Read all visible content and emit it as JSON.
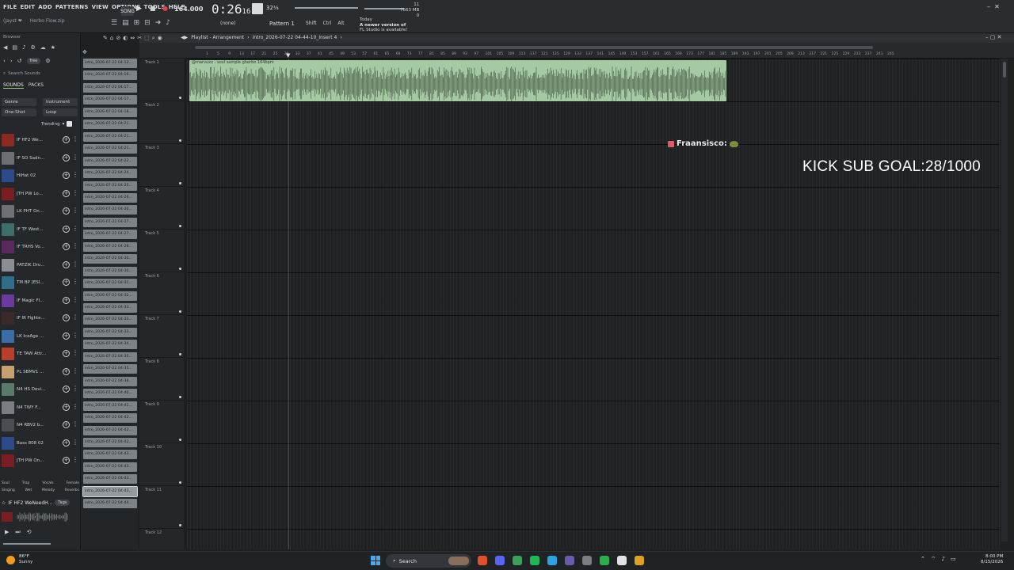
{
  "menu": [
    "FILE",
    "EDIT",
    "ADD",
    "PATTERNS",
    "VIEW",
    "OPTIONS",
    "TOOLS",
    "HELP"
  ],
  "hint_left": "(Jayst ❤",
  "hint_file": "Herbo Flow.zip",
  "transport": {
    "song_label": "SONG",
    "tempo": "164.000",
    "time_main": "0:26",
    "time_sub": "16",
    "snap": "32⅓"
  },
  "cpu": {
    "line1": "11",
    "line2": "7663 MB",
    "line3": "0"
  },
  "pattern_select": "(none)",
  "pattern": "Pattern 1",
  "modifier_keys": [
    "Shift",
    "Ctrl",
    "Alt"
  ],
  "update_notice": {
    "when": "Today",
    "text": "A newer version of",
    "text2": "FL Studio is available!"
  },
  "browser": {
    "title": "Browser",
    "free_pill": "free",
    "search_placeholder": "Search Sounds",
    "tabs": [
      "SOUNDS",
      "PACKS"
    ],
    "filters": [
      [
        "Genre",
        "Instrument"
      ],
      [
        "One-Shot",
        "Loop"
      ]
    ],
    "trending": "Trending",
    "sounds": [
      {
        "label": "IF HF2 We...",
        "color": "#8b2a1e"
      },
      {
        "label": "IF SO Sadn...",
        "color": "#6b6f73"
      },
      {
        "label": "HiHat 02",
        "color": "#2b4b8c"
      },
      {
        "label": "JTH PW Lo...",
        "color": "#7a1e22"
      },
      {
        "label": "LK PHT On...",
        "color": "#6d7175"
      },
      {
        "label": "IF TF West...",
        "color": "#3c6e6a"
      },
      {
        "label": "IF TRHS Vo...",
        "color": "#5a2a5e"
      },
      {
        "label": "PATZIK Dru...",
        "color": "#8a8e92"
      },
      {
        "label": "TM BP [ESI...",
        "color": "#2d6e8a"
      },
      {
        "label": "IF Magic Fl...",
        "color": "#6a3a9c"
      },
      {
        "label": "IF IR Fighte...",
        "color": "#3a2a2a"
      },
      {
        "label": "LK IceAge ...",
        "color": "#3a6ea8"
      },
      {
        "label": "TE TAW Attr...",
        "color": "#b8402a"
      },
      {
        "label": "PL SBMV1 ...",
        "color": "#c8a070"
      },
      {
        "label": "N4 HS Devi...",
        "color": "#5a7a6a"
      },
      {
        "label": "N4 TWY F...",
        "color": "#7a7e82"
      },
      {
        "label": "N4 RBV2 b...",
        "color": "#4a4e52"
      },
      {
        "label": "Bass 808 02",
        "color": "#2b4b8c"
      },
      {
        "label": "JTH PW On...",
        "color": "#7a1e22"
      }
    ],
    "tags": [
      [
        "Soul",
        "Trap",
        "Vocals",
        "Female"
      ],
      [
        "Singing",
        "Wet",
        "Melody",
        "Reverbs"
      ]
    ],
    "current_sound": "IF HF2 WeNeedH...",
    "current_tag": "Tags"
  },
  "clips": [
    "intro_2026-07-22 04-12...",
    "intro_2026-07-22 04-16...",
    "intro_2026-07-22 04-17...",
    "intro_2026-07-22 04-17...",
    "intro_2026-07-22 04-18...",
    "intro_2026-07-22 04-21...",
    "intro_2026-07-22 04-21...",
    "intro_2026-07-22 04-21...",
    "intro_2026-07-22 04-22...",
    "intro_2026-07-22 04-24...",
    "intro_2026-07-22 04-25...",
    "intro_2026-07-22 04-26...",
    "intro_2026-07-22 04-26...",
    "intro_2026-07-22 04-27...",
    "intro_2026-07-22 04-27...",
    "intro_2026-07-22 04-28...",
    "intro_2026-07-22 04-30...",
    "intro_2026-07-22 04-30...",
    "intro_2026-07-22 04-31...",
    "intro_2026-07-22 04-32...",
    "intro_2026-07-22 04-33...",
    "intro_2026-07-22 04-33...",
    "intro_2026-07-22 04-33...",
    "intro_2026-07-22 04-34...",
    "intro_2026-07-22 04-35...",
    "intro_2026-07-22 04-35...",
    "intro_2026-07-22 04-38...",
    "intro_2026-07-22 04-40...",
    "intro_2026-07-22 04-41...",
    "intro_2026-07-22 04-42...",
    "intro_2026-07-22 04-42...",
    "intro_2026-07-22 04-42...",
    "intro_2026-07-22 04-43...",
    "intro_2026-07-22 04-43...",
    "intro_2026-07-22 04-43...",
    "intro_2026-07-22 04-43...",
    "intro_2026-07-22 04-44..."
  ],
  "selected_clip_index": 35,
  "playlist": {
    "title": "Playlist - Arrangement",
    "breadcrumb": "intro_2026-07-22 04-44-10_Insert 4",
    "clip_caption": "@marvuxx - soul sample gherbo 164bpm",
    "ruler_marks": [
      "1",
      "5",
      "9",
      "13",
      "17",
      "21",
      "25",
      "29",
      "33",
      "37",
      "41",
      "45",
      "49",
      "53",
      "57",
      "61",
      "65",
      "69",
      "73",
      "77",
      "81",
      "85",
      "89",
      "93",
      "97",
      "101",
      "105",
      "109",
      "113",
      "117",
      "121",
      "125",
      "129",
      "133",
      "137",
      "141",
      "145",
      "149",
      "153",
      "157",
      "161",
      "165",
      "169",
      "173",
      "177",
      "181",
      "185",
      "189",
      "193",
      "197",
      "201",
      "205",
      "209",
      "213",
      "217",
      "221",
      "225",
      "229",
      "233",
      "237",
      "241",
      "245"
    ],
    "tracks": [
      "Track 1",
      "Track 2",
      "Track 3",
      "Track 4",
      "Track 5",
      "Track 6",
      "Track 7",
      "Track 8",
      "Track 9",
      "Track 10",
      "Track 11",
      "Track 12"
    ]
  },
  "overlay": {
    "name": "Fraansisco:",
    "goal": "KICK SUB GOAL:28/1000"
  },
  "taskbar": {
    "temp": "86°F",
    "weather": "Sunny",
    "search": "Search",
    "time": "8:00 PM",
    "date": "8/15/2026",
    "apps": [
      {
        "name": "brave",
        "color": "#e0502a"
      },
      {
        "name": "discord",
        "color": "#5865f2"
      },
      {
        "name": "fl-studio-a",
        "color": "#3aa05a"
      },
      {
        "name": "spotify",
        "color": "#1db954"
      },
      {
        "name": "telegram",
        "color": "#2aa3e0"
      },
      {
        "name": "fl-studio-active",
        "color": "#6a5ab0"
      },
      {
        "name": "settings",
        "color": "#7a7e82"
      },
      {
        "name": "green-app",
        "color": "#2ab04a"
      },
      {
        "name": "camera",
        "color": "#dfe3e6"
      },
      {
        "name": "shield",
        "color": "#e0a020"
      }
    ]
  },
  "colors": {
    "clip_green": "#a5c9a2",
    "wave": "#1f2a1f",
    "accent": "#9ad07a"
  }
}
